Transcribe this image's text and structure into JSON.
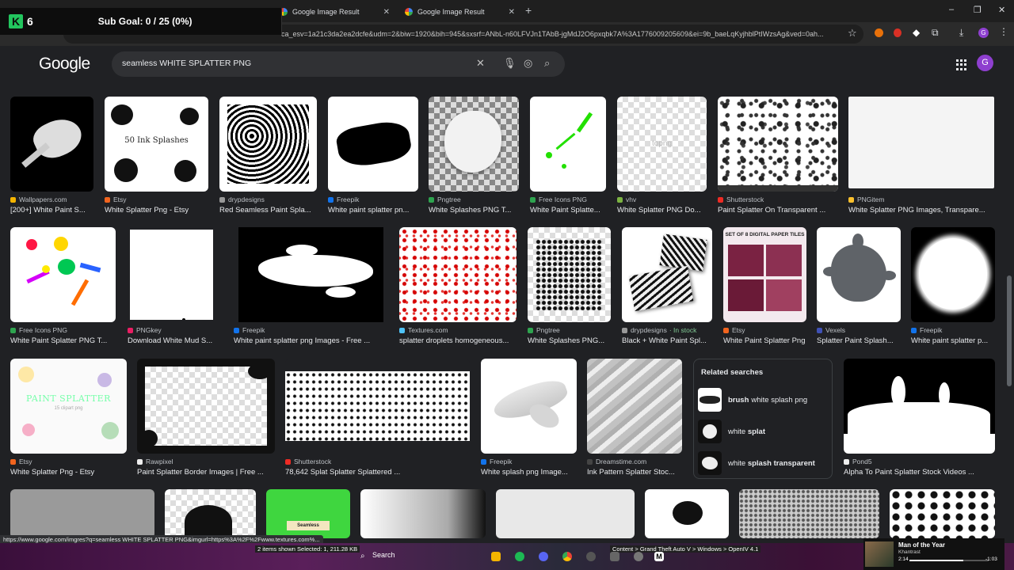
{
  "tabs": [
    {
      "title": "Google Image Result"
    },
    {
      "title": "Google Image Result"
    }
  ],
  "window_controls": {
    "new_tab": "+",
    "minimize": "–",
    "restore": "❐",
    "close": "✕"
  },
  "overlay": {
    "score": "6",
    "goal": "Sub Goal:  0 / 25 (0%)"
  },
  "address_bar": {
    "url": "ca_esv=1a21c3da2ea2dcfe&udm=2&biw=1920&bih=945&sxsrf=ANbL-n60LFVJn1TAbB-jgMdJ2O6pxqbk7A%3A1776009205609&ei=9b_baeLqKyjhblPtIWzsAg&ved=0ah..."
  },
  "google": {
    "logo": "Google",
    "query": "seamless WHITE SPLATTER PNG",
    "avatar_letter": "G"
  },
  "results_row1": [
    {
      "source": "Wallpapers.com",
      "title": "[200+] White Paint S..."
    },
    {
      "source": "Etsy",
      "title": "White Splatter Png - Etsy"
    },
    {
      "source": "drypdesigns",
      "title": "Red Seamless Paint Spla..."
    },
    {
      "source": "Freepik",
      "title": "White paint splatter pn..."
    },
    {
      "source": "Pngtree",
      "title": "White Splashes PNG T..."
    },
    {
      "source": "Free Icons PNG",
      "title": "White Paint Splatte..."
    },
    {
      "source": "vhv",
      "title": "White Splatter PNG Do..."
    },
    {
      "source": "Shutterstock",
      "title": "Paint Splatter On Transparent ..."
    },
    {
      "source": "PNGitem",
      "title": "White Splatter PNG Images, Transpare..."
    }
  ],
  "results_row2": [
    {
      "source": "Free Icons PNG",
      "title": "White Paint Splatter PNG T..."
    },
    {
      "source": "PNGkey",
      "title": "Download White Mud S..."
    },
    {
      "source": "Freepik",
      "title": "White paint splatter png Images - Free ..."
    },
    {
      "source": "Textures.com",
      "title": "splatter droplets homogeneous..."
    },
    {
      "source": "Pngtree",
      "title": "White Splashes PNG..."
    },
    {
      "source": "drypdesigns",
      "stock": "· In stock",
      "title": "Black + White Paint Spl..."
    },
    {
      "source": "Etsy",
      "title": "White Paint Splatter Png - ..."
    },
    {
      "source": "Vexels",
      "title": "Splatter Paint Splash..."
    },
    {
      "source": "Freepik",
      "title": "White paint splatter p..."
    }
  ],
  "results_row3": [
    {
      "source": "Etsy",
      "title": "White Splatter Png - Etsy",
      "img_text": "PAINT SPLATTER",
      "img_sub": "15 clipart png"
    },
    {
      "source": "Rawpixel",
      "title": "Paint Splatter Border Images | Free ..."
    },
    {
      "source": "Shutterstock",
      "title": "78,642 Splat Splatter Splattered ..."
    },
    {
      "source": "Freepik",
      "title": "White splash png Image..."
    },
    {
      "source": "Dreamstime.com",
      "title": "Ink Pattern Splatter Stoc..."
    },
    {
      "source": "Pond5",
      "title": "Alpha To Paint Splatter Stock Videos ..."
    }
  ],
  "row1_img_texts": {
    "etsy_label": "50 Ink Splashes",
    "watermark": "topng"
  },
  "row2_img_texts": {
    "etsy_label": "SET OF 8 DIGITAL PAPER TILES"
  },
  "row4_img_texts": {
    "seamless": "Seamless"
  },
  "related": {
    "heading": "Related searches",
    "items": [
      {
        "bold": "brush",
        "rest": "white splash png"
      },
      {
        "bold": "",
        "rest": "white splat",
        "bold_after": "splat",
        "pre": "white"
      },
      {
        "bold": "",
        "rest": "white splash transparent",
        "pre": "white",
        "bold_after": "splash transparent"
      }
    ]
  },
  "status_url": "https://www.google.com/imgres?q=seamless WHITE SPLATTER PNG&imgurl=https%3A%2F%2Fwww.textures.com%...",
  "taskbar": {
    "search": "Search",
    "explorer_info": "2 items shown  Selected: 1,  211.28 KB",
    "breadcrumb": "Content  >  Grand Theft Auto V  >  Windows  >  OpenIV 4.1",
    "media_title": "Man of the Year",
    "media_artist": "Khantrast",
    "media_time_left": "2:14",
    "media_time_right": "-1:03"
  },
  "colors": {
    "bg": "#202124",
    "search_bg": "#303134",
    "avatar": "#8e3fcf",
    "accent_green": "#22c55e"
  }
}
